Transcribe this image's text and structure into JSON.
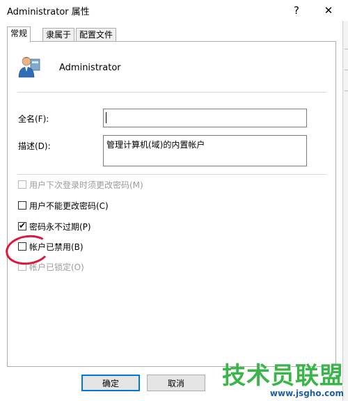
{
  "window": {
    "title": "Administrator 属性",
    "help_glyph": "?",
    "close_glyph": "✕"
  },
  "tabs": [
    {
      "label": "常规",
      "active": true
    },
    {
      "label": "隶属于",
      "active": false
    },
    {
      "label": "配置文件",
      "active": false
    }
  ],
  "user": {
    "name": "Administrator",
    "icon": "user-icon"
  },
  "fields": {
    "full_name": {
      "label": "全名(F):",
      "value": ""
    },
    "description": {
      "label": "描述(D):",
      "value": "管理计算机(域)的内置帐户"
    }
  },
  "options": [
    {
      "label": "用户下次登录时须更改密码(M)",
      "checked": false,
      "disabled": true
    },
    {
      "label": "用户不能更改密码(C)",
      "checked": false,
      "disabled": false
    },
    {
      "label": "密码永不过期(P)",
      "checked": true,
      "disabled": false
    },
    {
      "label": "帐户已禁用(B)",
      "checked": false,
      "disabled": false,
      "highlighted": true
    },
    {
      "label": "帐户已锁定(O)",
      "checked": false,
      "disabled": true
    }
  ],
  "buttons": {
    "ok": "确定",
    "cancel": "取消"
  },
  "watermark": {
    "brand": "技术员联盟",
    "url": "www.jsgho.com"
  },
  "colors": {
    "accent": "#0078d7",
    "highlight_circle": "#e0143c",
    "watermark_green": "#39b54a"
  }
}
